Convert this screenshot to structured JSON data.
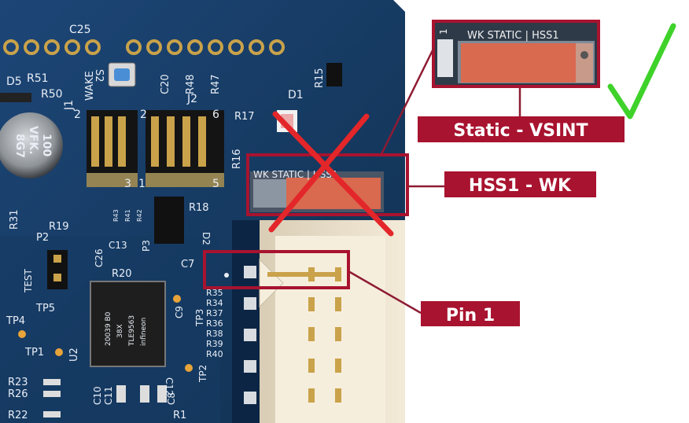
{
  "colors": {
    "pcb": "#163a63",
    "pcb_dark": "#0f2b4c",
    "label_bg": "#a8132f",
    "leader": "#8e1b33",
    "cross": "#e3262a",
    "check": "#3fd22a",
    "connector": "#efe4cf",
    "switch_knob": "#d9694f"
  },
  "labels": {
    "static_vsint": "Static - VSINT",
    "hss1_wk": "HSS1 - WK",
    "pin1": "Pin 1"
  },
  "switch_inset": {
    "legend": "WK  STATIC | HSS1",
    "corner_mark": "1"
  },
  "board_switch": {
    "legend": "WK  STATIC | HSS1"
  },
  "marks": {
    "correct": "check-mark-icon",
    "wrong": "cross-mark-icon"
  },
  "silkscreen": {
    "c25": "C25",
    "s2": "S2",
    "wake": "WAKE",
    "c20": "C20",
    "r48": "R48",
    "r47": "R47",
    "r15": "R15",
    "d5": "D5",
    "r51": "R51",
    "r50": "R50",
    "j1": "J1",
    "j2": "J2",
    "d1": "D1",
    "r17": "R17",
    "r16": "R16",
    "r18": "R18",
    "r43": "R43",
    "r41": "R41",
    "r42": "R42",
    "p3": "P3",
    "d2": "D2",
    "r31": "R31",
    "r19": "R19",
    "p2": "P2",
    "c26": "C26",
    "c13": "C13",
    "r20": "R20",
    "c7": "C7",
    "test": "TEST",
    "tp5": "TP5",
    "tp4": "TP4",
    "tp1": "TP1",
    "u2": "U2",
    "c9": "C9",
    "tp3": "TP3",
    "r35": "R35",
    "r34": "R34",
    "r37": "R37",
    "r36": "R36",
    "r38": "R38",
    "r39": "R39",
    "r40": "R40",
    "tp2": "TP2",
    "r23": "R23",
    "r26": "R26",
    "r22": "R22",
    "c10": "C10",
    "c11": "C11",
    "c8": "C8",
    "c12": "C12",
    "r1": "R1",
    "hdr_2a": "2",
    "hdr_3": "3",
    "hdr_1": "1",
    "hdr_2b": "2",
    "hdr_5": "5",
    "hdr_6": "6",
    "cap_line1": "100",
    "cap_line2": "VFK.",
    "cap_line3": "8G7",
    "chip_line1": "20039 B0",
    "chip_line2": "38X",
    "chip_line3": "TLE9563",
    "chip_line4": "infineon"
  }
}
